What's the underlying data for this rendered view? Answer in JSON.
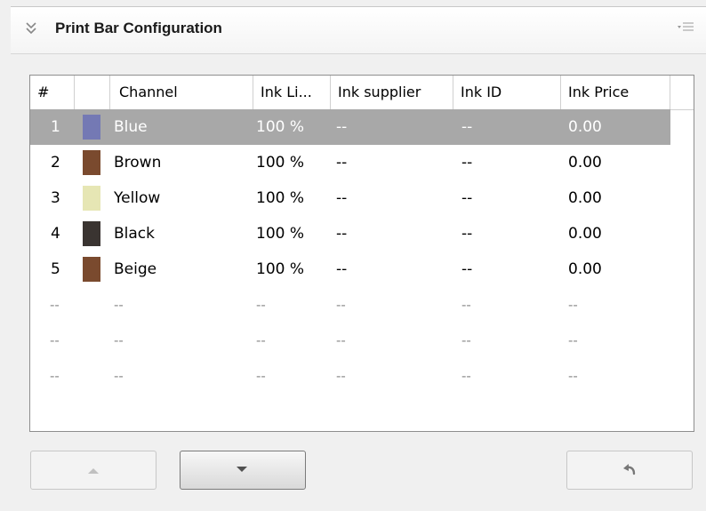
{
  "panel": {
    "title": "Print Bar Configuration",
    "collapse_icon": "double-chevron-down-icon",
    "menu_icon": "panel-menu-icon"
  },
  "table": {
    "columns": [
      "#",
      "",
      "Channel",
      "Ink Li...",
      "Ink supplier",
      "Ink ID",
      "Ink Price"
    ],
    "rows": [
      {
        "num": "1",
        "color": "#7479b4",
        "channel": "Blue",
        "ink_limit": "100 %",
        "supplier": "--",
        "ink_id": "--",
        "price": "0.00",
        "selected": true
      },
      {
        "num": "2",
        "color": "#7a4a2e",
        "channel": "Brown",
        "ink_limit": "100 %",
        "supplier": "--",
        "ink_id": "--",
        "price": "0.00",
        "selected": false
      },
      {
        "num": "3",
        "color": "#e6e6b4",
        "channel": "Yellow",
        "ink_limit": "100 %",
        "supplier": "--",
        "ink_id": "--",
        "price": "0.00",
        "selected": false
      },
      {
        "num": "4",
        "color": "#3a3431",
        "channel": "Black",
        "ink_limit": "100 %",
        "supplier": "--",
        "ink_id": "--",
        "price": "0.00",
        "selected": false
      },
      {
        "num": "5",
        "color": "#7a4a2e",
        "channel": "Beige",
        "ink_limit": "100 %",
        "supplier": "--",
        "ink_id": "--",
        "price": "0.00",
        "selected": false
      }
    ],
    "placeholder_rows": [
      {
        "num": "--",
        "channel": "--",
        "ink_limit": "--",
        "supplier": "--",
        "ink_id": "--",
        "price": "--"
      },
      {
        "num": "--",
        "channel": "--",
        "ink_limit": "--",
        "supplier": "--",
        "ink_id": "--",
        "price": "--"
      },
      {
        "num": "--",
        "channel": "--",
        "ink_limit": "--",
        "supplier": "--",
        "ink_id": "--",
        "price": "--"
      }
    ]
  },
  "buttons": {
    "move_up": {
      "icon": "arrow-up-icon",
      "enabled": false
    },
    "move_down": {
      "icon": "arrow-down-icon",
      "enabled": true
    },
    "revert": {
      "icon": "undo-icon",
      "enabled": true
    }
  },
  "colors": {
    "selection": "#a8a8a8",
    "border": "#8e8e8e"
  }
}
